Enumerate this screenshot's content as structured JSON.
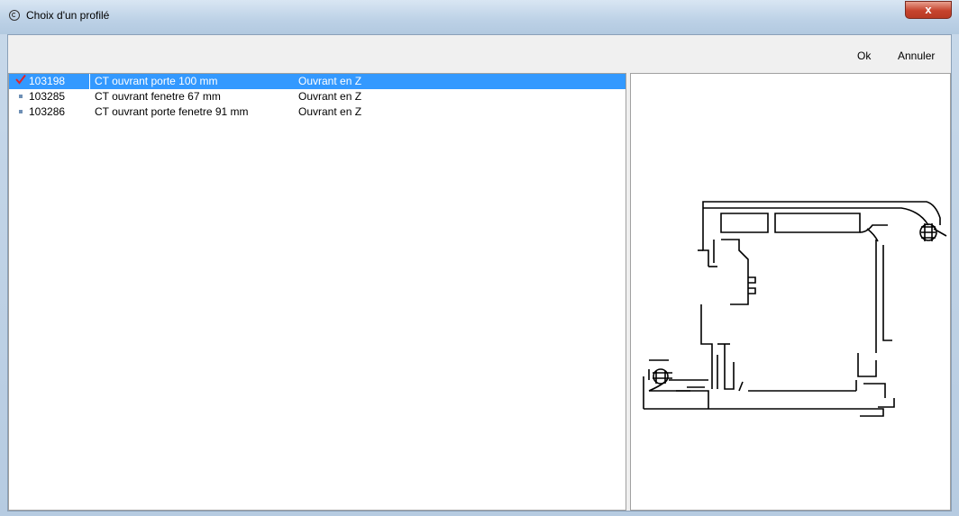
{
  "window": {
    "title": "Choix d'un  profilé",
    "close_label": "x"
  },
  "toolbar": {
    "ok_label": "Ok",
    "cancel_label": "Annuler"
  },
  "profiles": [
    {
      "code": "103198",
      "description": "CT ouvrant porte 100 mm",
      "type": "Ouvrant en Z",
      "selected": true
    },
    {
      "code": "103285",
      "description": "CT ouvrant  fenetre 67 mm",
      "type": "Ouvrant en Z",
      "selected": false
    },
    {
      "code": "103286",
      "description": "CT ouvrant porte fenetre 91 mm",
      "type": "Ouvrant en Z",
      "selected": false
    }
  ],
  "colors": {
    "selection": "#3399ff",
    "check": "#e0242a"
  },
  "preview": {
    "icon": "profile-cross-section-drawing"
  }
}
